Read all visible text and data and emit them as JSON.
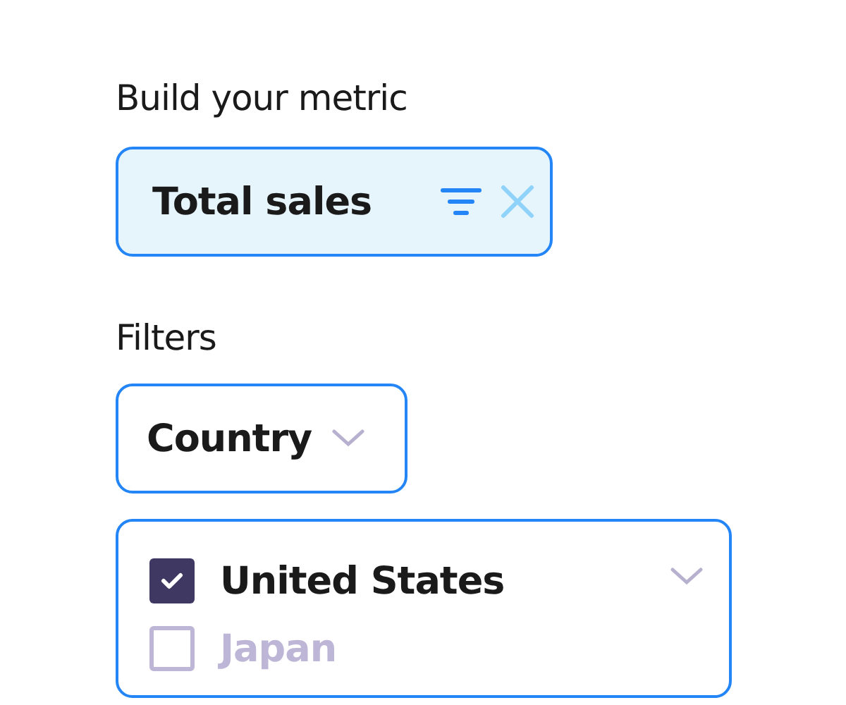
{
  "metric": {
    "label": "Build your metric",
    "value": "Total sales"
  },
  "filters": {
    "label": "Filters",
    "dropdown": "Country",
    "options": [
      {
        "label": "United States",
        "checked": true
      },
      {
        "label": "Japan",
        "checked": false
      }
    ]
  }
}
